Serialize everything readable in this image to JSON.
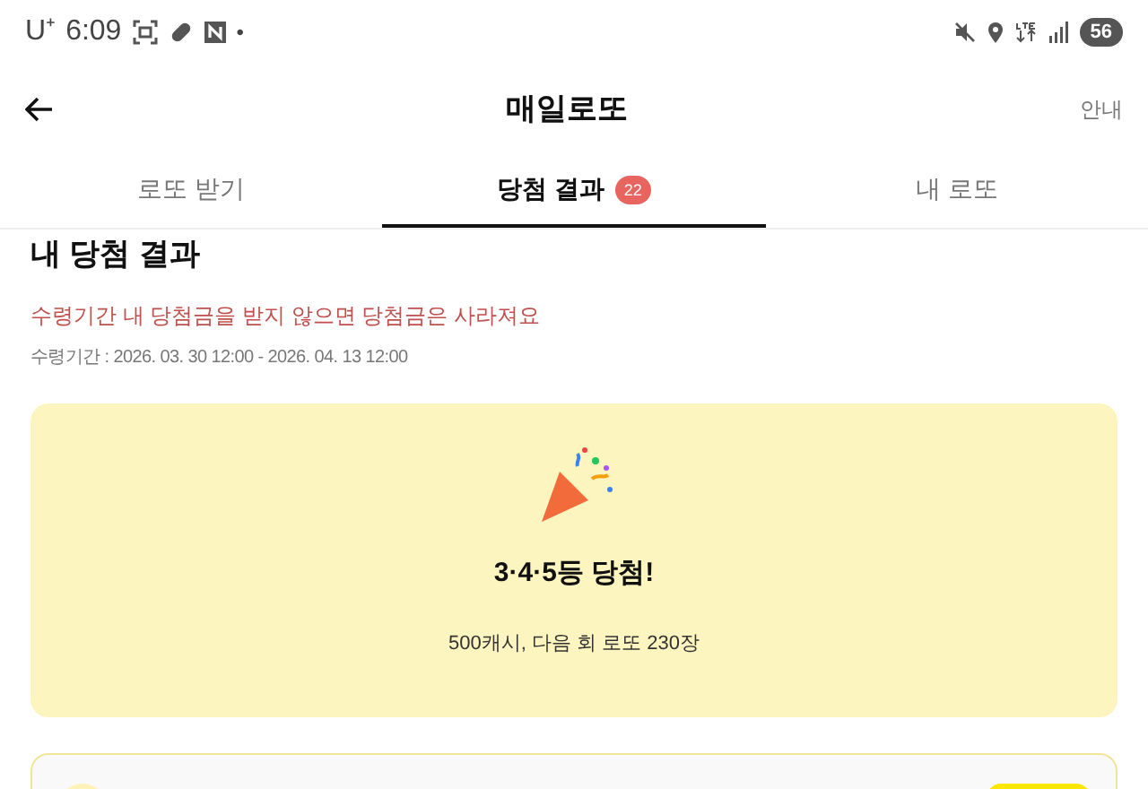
{
  "status_bar": {
    "carrier": "U⁺",
    "time": "6:09",
    "notification_dot": "•",
    "battery": "56"
  },
  "header": {
    "title": "매일로또",
    "action": "안내"
  },
  "tabs": [
    {
      "label": "로또 받기",
      "selected": false
    },
    {
      "label": "당첨 결과",
      "selected": true,
      "badge": "22"
    },
    {
      "label": "내 로또",
      "selected": false
    }
  ],
  "section": {
    "title": "내 당첨 결과",
    "warning": "수령기간 내 당첨금을 받지 않으면 당첨금은 사라져요",
    "period": "수령기간 : 2026. 03. 30 12:00 - 2026. 04. 13 12:00"
  },
  "result_card": {
    "headline": "3·4·5등 당첨!",
    "detail": "500캐시, 다음 회 로또 230장"
  }
}
